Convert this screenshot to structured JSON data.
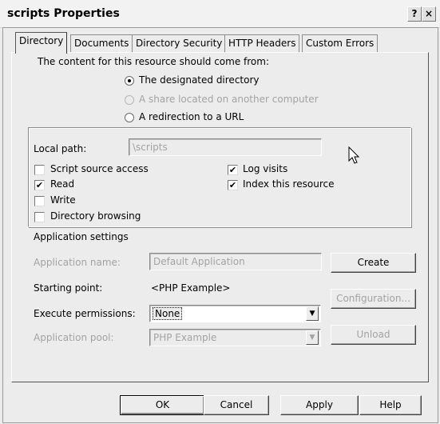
{
  "window": {
    "title": "scripts Properties",
    "help_button": "?",
    "close_button": "×"
  },
  "tabs": [
    {
      "label": "Directory",
      "active": true
    },
    {
      "label": "Documents"
    },
    {
      "label": "Directory Security"
    },
    {
      "label": "HTTP Headers"
    },
    {
      "label": "Custom Errors"
    }
  ],
  "content_source": {
    "heading": "The content for this resource should come from:",
    "options": [
      {
        "label": "The designated directory",
        "selected": true,
        "enabled": true
      },
      {
        "label": "A share located on another computer",
        "selected": false,
        "enabled": false
      },
      {
        "label": "A redirection to a URL",
        "selected": false,
        "enabled": true
      }
    ]
  },
  "local_path": {
    "label": "Local path:",
    "value": "\\scripts"
  },
  "permissions": [
    {
      "label": "Script source access",
      "checked": false
    },
    {
      "label": "Read",
      "checked": true
    },
    {
      "label": "Write",
      "checked": false
    },
    {
      "label": "Directory browsing",
      "checked": false
    },
    {
      "label": "Log visits",
      "checked": true
    },
    {
      "label": "Index this resource",
      "checked": true
    }
  ],
  "app_settings": {
    "heading": "Application settings",
    "app_name_label": "Application name:",
    "app_name_value": "Default Application",
    "create_button": "Create",
    "starting_point_label": "Starting point:",
    "starting_point_value": "<PHP Example>",
    "configuration_button": "Configuration...",
    "exec_perm_label": "Execute permissions:",
    "exec_perm_value": "None",
    "app_pool_label": "Application pool:",
    "app_pool_value": "PHP Example",
    "unload_button": "Unload"
  },
  "footer": {
    "ok": "OK",
    "cancel": "Cancel",
    "apply": "Apply",
    "help": "Help"
  },
  "checkmark": "✔"
}
